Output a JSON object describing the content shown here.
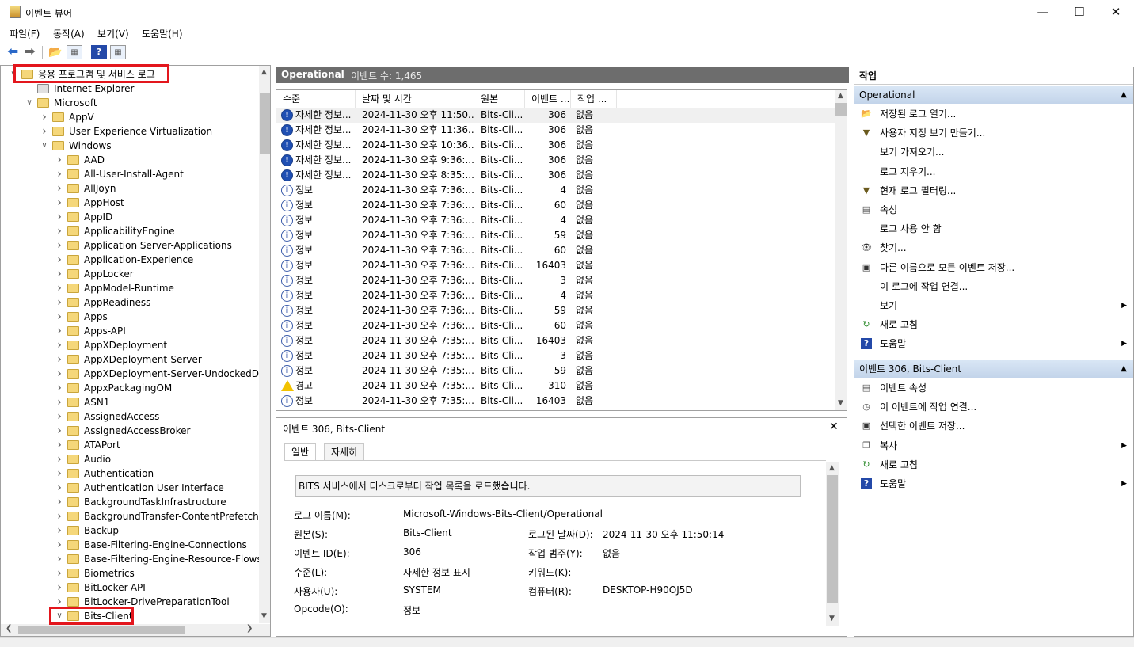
{
  "window": {
    "title": "이벤트 뷰어"
  },
  "menu": [
    "파일(F)",
    "동작(A)",
    "보기(V)",
    "도움말(H)"
  ],
  "tree": [
    {
      "label": "응용 프로그램 및 서비스 로그",
      "level": 0,
      "arrow": "down"
    },
    {
      "label": "Internet Explorer",
      "level": 1,
      "arrow": ""
    },
    {
      "label": "Microsoft",
      "level": 1,
      "arrow": "down"
    },
    {
      "label": "AppV",
      "level": 2,
      "arrow": "right"
    },
    {
      "label": "User Experience Virtualization",
      "level": 2,
      "arrow": "right"
    },
    {
      "label": "Windows",
      "level": 2,
      "arrow": "down"
    },
    {
      "label": "AAD",
      "level": 3,
      "arrow": "right"
    },
    {
      "label": "All-User-Install-Agent",
      "level": 3,
      "arrow": "right"
    },
    {
      "label": "AllJoyn",
      "level": 3,
      "arrow": "right"
    },
    {
      "label": "AppHost",
      "level": 3,
      "arrow": "right"
    },
    {
      "label": "AppID",
      "level": 3,
      "arrow": "right"
    },
    {
      "label": "ApplicabilityEngine",
      "level": 3,
      "arrow": "right"
    },
    {
      "label": "Application Server-Applications",
      "level": 3,
      "arrow": "right"
    },
    {
      "label": "Application-Experience",
      "level": 3,
      "arrow": "right"
    },
    {
      "label": "AppLocker",
      "level": 3,
      "arrow": "right"
    },
    {
      "label": "AppModel-Runtime",
      "level": 3,
      "arrow": "right"
    },
    {
      "label": "AppReadiness",
      "level": 3,
      "arrow": "right"
    },
    {
      "label": "Apps",
      "level": 3,
      "arrow": "right"
    },
    {
      "label": "Apps-API",
      "level": 3,
      "arrow": "right"
    },
    {
      "label": "AppXDeployment",
      "level": 3,
      "arrow": "right"
    },
    {
      "label": "AppXDeployment-Server",
      "level": 3,
      "arrow": "right"
    },
    {
      "label": "AppXDeployment-Server-UndockedDeh",
      "level": 3,
      "arrow": "right"
    },
    {
      "label": "AppxPackagingOM",
      "level": 3,
      "arrow": "right"
    },
    {
      "label": "ASN1",
      "level": 3,
      "arrow": "right"
    },
    {
      "label": "AssignedAccess",
      "level": 3,
      "arrow": "right"
    },
    {
      "label": "AssignedAccessBroker",
      "level": 3,
      "arrow": "right"
    },
    {
      "label": "ATAPort",
      "level": 3,
      "arrow": "right"
    },
    {
      "label": "Audio",
      "level": 3,
      "arrow": "right"
    },
    {
      "label": "Authentication",
      "level": 3,
      "arrow": "right"
    },
    {
      "label": "Authentication User Interface",
      "level": 3,
      "arrow": "right"
    },
    {
      "label": "BackgroundTaskInfrastructure",
      "level": 3,
      "arrow": "right"
    },
    {
      "label": "BackgroundTransfer-ContentPrefetcher",
      "level": 3,
      "arrow": "right"
    },
    {
      "label": "Backup",
      "level": 3,
      "arrow": "right"
    },
    {
      "label": "Base-Filtering-Engine-Connections",
      "level": 3,
      "arrow": "right"
    },
    {
      "label": "Base-Filtering-Engine-Resource-Flows",
      "level": 3,
      "arrow": "right"
    },
    {
      "label": "Biometrics",
      "level": 3,
      "arrow": "right"
    },
    {
      "label": "BitLocker-API",
      "level": 3,
      "arrow": "right"
    },
    {
      "label": "BitLocker-DrivePreparationTool",
      "level": 3,
      "arrow": "right"
    },
    {
      "label": "Bits-Client",
      "level": 3,
      "arrow": "down"
    }
  ],
  "list": {
    "title": "Operational",
    "count_label": "이벤트 수: 1,465",
    "columns": [
      "수준",
      "날짜 및 시간",
      "원본",
      "이벤트 ...",
      "작업 ..."
    ],
    "rows": [
      {
        "type": "verbose",
        "level": "자세한 정보...",
        "date": "2024-11-30 오후 11:50...",
        "source": "Bits-Cli...",
        "id": "306",
        "task": "없음"
      },
      {
        "type": "verbose",
        "level": "자세한 정보...",
        "date": "2024-11-30 오후 11:36...",
        "source": "Bits-Cli...",
        "id": "306",
        "task": "없음"
      },
      {
        "type": "verbose",
        "level": "자세한 정보...",
        "date": "2024-11-30 오후 10:36...",
        "source": "Bits-Cli...",
        "id": "306",
        "task": "없음"
      },
      {
        "type": "verbose",
        "level": "자세한 정보...",
        "date": "2024-11-30 오후 9:36:...",
        "source": "Bits-Cli...",
        "id": "306",
        "task": "없음"
      },
      {
        "type": "verbose",
        "level": "자세한 정보...",
        "date": "2024-11-30 오후 8:35:...",
        "source": "Bits-Cli...",
        "id": "306",
        "task": "없음"
      },
      {
        "type": "info",
        "level": "정보",
        "date": "2024-11-30 오후 7:36:...",
        "source": "Bits-Cli...",
        "id": "4",
        "task": "없음"
      },
      {
        "type": "info",
        "level": "정보",
        "date": "2024-11-30 오후 7:36:...",
        "source": "Bits-Cli...",
        "id": "60",
        "task": "없음"
      },
      {
        "type": "info",
        "level": "정보",
        "date": "2024-11-30 오후 7:36:...",
        "source": "Bits-Cli...",
        "id": "4",
        "task": "없음"
      },
      {
        "type": "info",
        "level": "정보",
        "date": "2024-11-30 오후 7:36:...",
        "source": "Bits-Cli...",
        "id": "59",
        "task": "없음"
      },
      {
        "type": "info",
        "level": "정보",
        "date": "2024-11-30 오후 7:36:...",
        "source": "Bits-Cli...",
        "id": "60",
        "task": "없음"
      },
      {
        "type": "info",
        "level": "정보",
        "date": "2024-11-30 오후 7:36:...",
        "source": "Bits-Cli...",
        "id": "16403",
        "task": "없음"
      },
      {
        "type": "info",
        "level": "정보",
        "date": "2024-11-30 오후 7:36:...",
        "source": "Bits-Cli...",
        "id": "3",
        "task": "없음"
      },
      {
        "type": "info",
        "level": "정보",
        "date": "2024-11-30 오후 7:36:...",
        "source": "Bits-Cli...",
        "id": "4",
        "task": "없음"
      },
      {
        "type": "info",
        "level": "정보",
        "date": "2024-11-30 오후 7:36:...",
        "source": "Bits-Cli...",
        "id": "59",
        "task": "없음"
      },
      {
        "type": "info",
        "level": "정보",
        "date": "2024-11-30 오후 7:36:...",
        "source": "Bits-Cli...",
        "id": "60",
        "task": "없음"
      },
      {
        "type": "info",
        "level": "정보",
        "date": "2024-11-30 오후 7:35:...",
        "source": "Bits-Cli...",
        "id": "16403",
        "task": "없음"
      },
      {
        "type": "info",
        "level": "정보",
        "date": "2024-11-30 오후 7:35:...",
        "source": "Bits-Cli...",
        "id": "3",
        "task": "없음"
      },
      {
        "type": "info",
        "level": "정보",
        "date": "2024-11-30 오후 7:35:...",
        "source": "Bits-Cli...",
        "id": "59",
        "task": "없음"
      },
      {
        "type": "warning",
        "level": "경고",
        "date": "2024-11-30 오후 7:35:...",
        "source": "Bits-Cli...",
        "id": "310",
        "task": "없음"
      },
      {
        "type": "info",
        "level": "정보",
        "date": "2024-11-30 오후 7:35:...",
        "source": "Bits-Cli...",
        "id": "16403",
        "task": "없음"
      }
    ]
  },
  "detail": {
    "title": "이벤트 306, Bits-Client",
    "tabs": [
      "일반",
      "자세히"
    ],
    "description": "BITS 서비스에서 디스크로부터 작업 목록을 로드했습니다.",
    "log_name_label": "로그 이름(M):",
    "log_name": "Microsoft-Windows-Bits-Client/Operational",
    "source_label": "원본(S):",
    "source": "Bits-Client",
    "logged_label": "로그된 날짜(D):",
    "logged": "2024-11-30 오후 11:50:14",
    "event_id_label": "이벤트 ID(E):",
    "event_id": "306",
    "task_label": "작업 범주(Y):",
    "task": "없음",
    "level_label": "수준(L):",
    "level": "자세한 정보 표시",
    "keywords_label": "키워드(K):",
    "user_label": "사용자(U):",
    "user": "SYSTEM",
    "computer_label": "컴퓨터(R):",
    "computer": "DESKTOP-H90OJ5D",
    "opcode_label": "Opcode(O):",
    "opcode": "정보"
  },
  "actions": {
    "header": "작업",
    "section1": "Operational",
    "items1": [
      {
        "icon": "open-folder-icon",
        "label": "저장된 로그 열기..."
      },
      {
        "icon": "filter-icon",
        "label": "사용자 지정 보기 만들기..."
      },
      {
        "icon": "",
        "label": "보기 가져오기..."
      },
      {
        "icon": "",
        "label": "로그 지우기..."
      },
      {
        "icon": "filter-icon",
        "label": "현재 로그 필터링..."
      },
      {
        "icon": "properties-icon",
        "label": "속성"
      },
      {
        "icon": "",
        "label": "로그 사용 안 함"
      },
      {
        "icon": "binoculars-icon",
        "label": "찾기..."
      },
      {
        "icon": "save-icon",
        "label": "다른 이름으로 모든 이벤트 저장..."
      },
      {
        "icon": "",
        "label": "이 로그에 작업 연결..."
      },
      {
        "icon": "",
        "label": "보기",
        "sub": true
      },
      {
        "icon": "refresh-icon",
        "label": "새로 고침"
      },
      {
        "icon": "help-icon",
        "label": "도움말",
        "sub": true
      }
    ],
    "section2": "이벤트 306, Bits-Client",
    "items2": [
      {
        "icon": "properties-icon",
        "label": "이벤트 속성"
      },
      {
        "icon": "task-icon",
        "label": "이 이벤트에 작업 연결..."
      },
      {
        "icon": "save-icon",
        "label": "선택한 이벤트 저장..."
      },
      {
        "icon": "copy-icon",
        "label": "복사",
        "sub": true
      },
      {
        "icon": "refresh-icon",
        "label": "새로 고침"
      },
      {
        "icon": "help-icon",
        "label": "도움말",
        "sub": true
      }
    ]
  },
  "colors": {
    "highlight": "#e3161d",
    "header_gray": "#6d6d6d",
    "section_blue": "#c3d4ea"
  }
}
